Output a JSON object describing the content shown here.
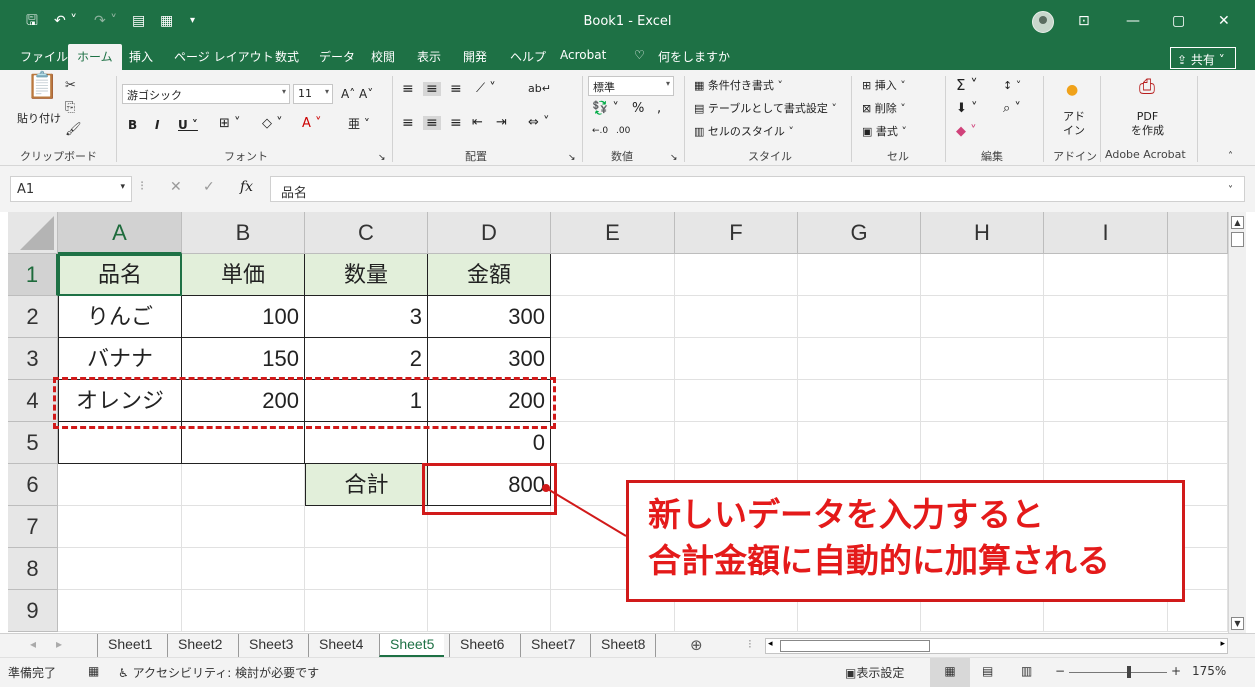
{
  "titlebar": {
    "title": "Book1  -  Excel",
    "save_icon": "save-icon",
    "undo_icon": "undo-icon",
    "minimize": "—",
    "restore": "▢",
    "close": "✕"
  },
  "menu": {
    "tabs": [
      "ファイル",
      "ホーム",
      "挿入",
      "ページ レイアウト",
      "数式",
      "データ",
      "校閲",
      "表示",
      "開発",
      "ヘルプ",
      "Acrobat"
    ],
    "search": "何をしますか",
    "share": "共有"
  },
  "ribbon": {
    "paste": "貼り付け",
    "clipboard": "クリップボード",
    "font_name": "游ゴシック",
    "font_size": "11",
    "font_group": "フォント",
    "align_group": "配置",
    "number_format": "標準",
    "number_group": "数値",
    "cond_format": "条件付き書式",
    "table_format": "テーブルとして書式設定",
    "cell_style": "セルのスタイル",
    "style_group": "スタイル",
    "insert": "挿入",
    "delete": "削除",
    "format": "書式",
    "cells_group": "セル",
    "edit_group": "編集",
    "addin": "アド\nイン",
    "addin_group": "アドイン",
    "pdf_create": "PDF\nを作成",
    "acrobat_group": "Adobe Acrobat"
  },
  "formula_bar": {
    "name_box": "A1",
    "fx": "fx",
    "content": "品名"
  },
  "sheet": {
    "columns": [
      "A",
      "B",
      "C",
      "D",
      "E",
      "F",
      "G",
      "H",
      "I"
    ],
    "rows": [
      "1",
      "2",
      "3",
      "4",
      "5",
      "6",
      "7",
      "8",
      "9"
    ],
    "header": [
      "品名",
      "単価",
      "数量",
      "金額"
    ],
    "data": [
      [
        "りんご",
        "100",
        "3",
        "300"
      ],
      [
        "バナナ",
        "150",
        "2",
        "300"
      ],
      [
        "オレンジ",
        "200",
        "1",
        "200"
      ],
      [
        "",
        "",
        "",
        "0"
      ]
    ],
    "total_label": "合計",
    "total_value": "800"
  },
  "callout": {
    "line1": "新しいデータを入力すると",
    "line2": "合計金額に自動的に加算される"
  },
  "sheet_tabs": {
    "tabs": [
      "Sheet1",
      "Sheet2",
      "Sheet3",
      "Sheet4",
      "Sheet5",
      "Sheet6",
      "Sheet7",
      "Sheet8"
    ],
    "active": "Sheet5"
  },
  "status": {
    "ready": "準備完了",
    "accessibility": "アクセシビリティ: 検討が必要です",
    "display_settings": "表示設定",
    "zoom": "175%"
  }
}
